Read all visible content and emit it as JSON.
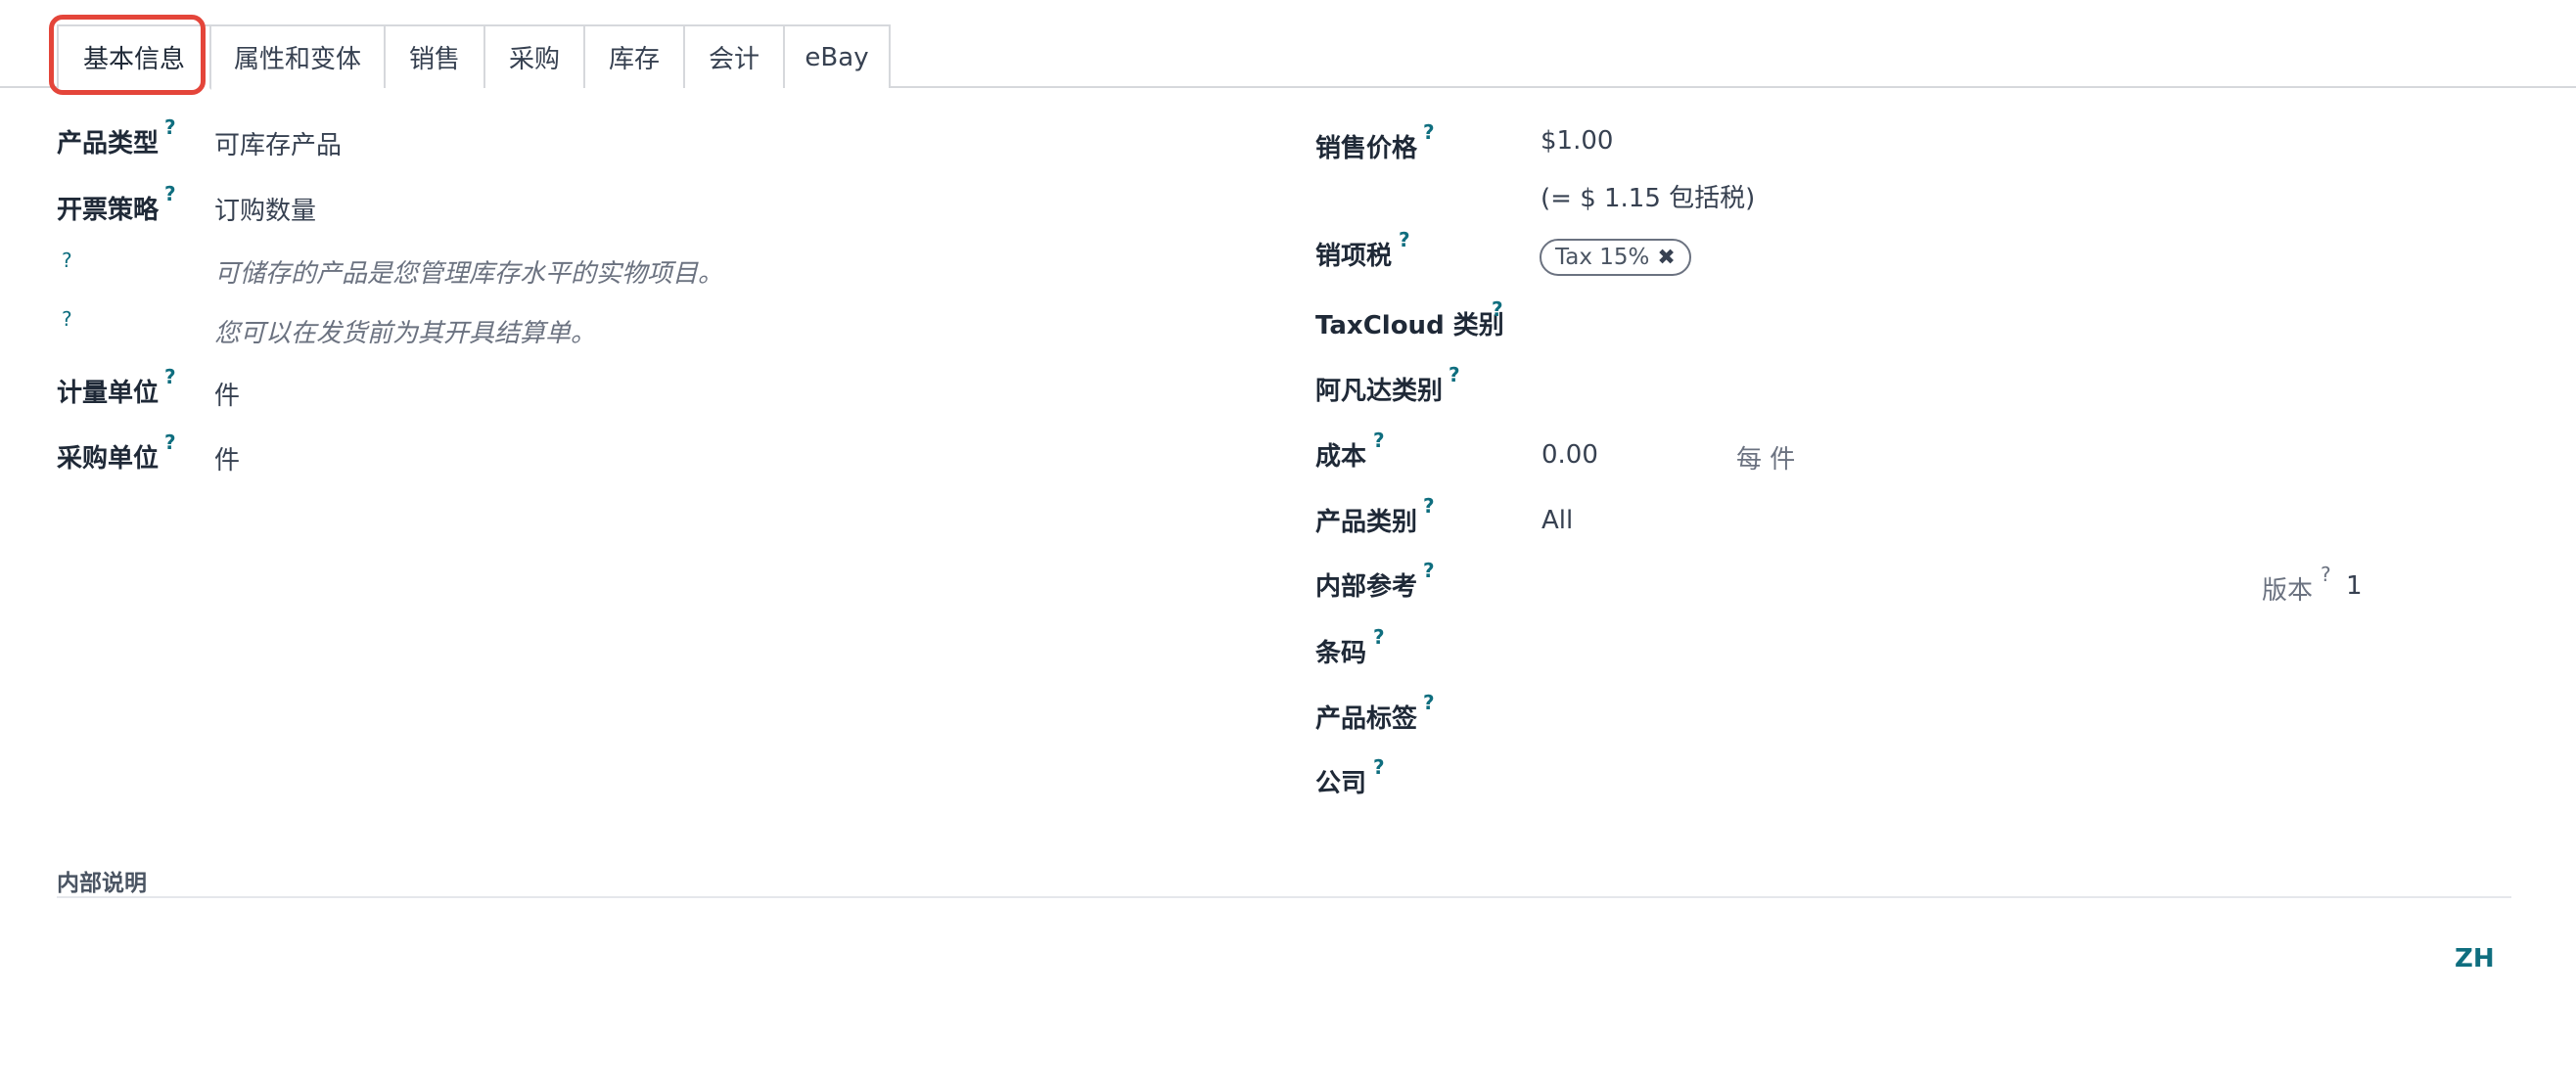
{
  "tabs": [
    {
      "label": "基本信息"
    },
    {
      "label": "属性和变体"
    },
    {
      "label": "销售"
    },
    {
      "label": "采购"
    },
    {
      "label": "库存"
    },
    {
      "label": "会计"
    },
    {
      "label": "eBay"
    }
  ],
  "help_mark": "?",
  "left": {
    "product_type_label": "产品类型",
    "product_type_value": "可库存产品",
    "invoice_policy_label": "开票策略",
    "invoice_policy_value": "订购数量",
    "hint1": "可储存的产品是您管理库存水平的实物项目。",
    "hint2": "您可以在发货前为其开具结算单。",
    "uom_label": "计量单位",
    "uom_value": "件",
    "purchase_uom_label": "采购单位",
    "purchase_uom_value": "件"
  },
  "right": {
    "sale_price_label": "销售价格",
    "sale_price_value": "$1.00",
    "sale_price_incl": "(= $ 1.15 包括税)",
    "sale_tax_label": "销项税",
    "sale_tax_tag": "Tax 15%",
    "sale_tax_remove": "✖",
    "taxcloud_label": "TaxCloud 类别",
    "avatax_label": "阿凡达类别",
    "cost_label": "成本",
    "cost_value": "0.00",
    "cost_unit": "每 件",
    "category_label": "产品类别",
    "category_value": "All",
    "internal_ref_label": "内部参考",
    "version_label": "版本",
    "version_value": "1",
    "barcode_label": "条码",
    "tags_label": "产品标签",
    "company_label": "公司"
  },
  "notes": {
    "title": "内部说明"
  },
  "lang_button": "ZH"
}
